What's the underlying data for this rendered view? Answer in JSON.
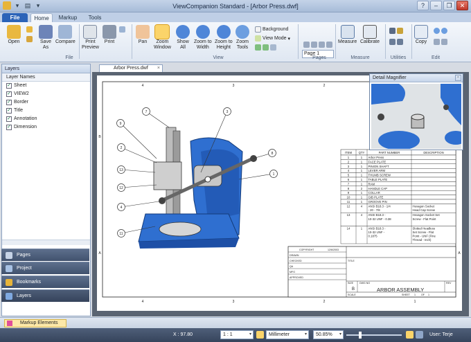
{
  "window": {
    "title": "ViewCompanion Standard - [Arbor Press.dwf]"
  },
  "ribbon_tabs": [
    {
      "label": "File"
    },
    {
      "label": "Home"
    },
    {
      "label": "Markup"
    },
    {
      "label": "Tools"
    }
  ],
  "ribbon": {
    "buttons": [
      {
        "label": "Open"
      },
      {
        "label": "Save\nAs"
      },
      {
        "label": "Compare"
      },
      {
        "label": "Print\nPreview"
      },
      {
        "label": "Print"
      },
      {
        "label": "Pan"
      },
      {
        "label": "Zoom\nWindow"
      },
      {
        "label": "Show\nAll"
      },
      {
        "label": "Zoom to\nWidth"
      },
      {
        "label": "Zoom to\nHeight"
      },
      {
        "label": "Zoom\nTools"
      },
      {
        "label": "Measure"
      },
      {
        "label": "Calibrate"
      },
      {
        "label": "Copy"
      }
    ],
    "small": {
      "background": "Background",
      "view_mode": "View Mode"
    },
    "page_select": "Page 1",
    "groups": {
      "file": "File",
      "view": "View",
      "pages": "Pages",
      "measure": "Measure",
      "utilities": "Utilities",
      "edit": "Edit"
    }
  },
  "layers_panel": {
    "title": "Layers",
    "column": "Layer Names",
    "items": [
      {
        "name": "Sheet",
        "checked": true
      },
      {
        "name": "VIEW2",
        "checked": true
      },
      {
        "name": "Border",
        "checked": true
      },
      {
        "name": "Title",
        "checked": true
      },
      {
        "name": "Annotation",
        "checked": true
      },
      {
        "name": "Dimension",
        "checked": true
      }
    ]
  },
  "nav_buttons": [
    {
      "label": "Pages"
    },
    {
      "label": "Project"
    },
    {
      "label": "Bookmarks"
    },
    {
      "label": "Layers"
    }
  ],
  "document_tab": {
    "label": "Arbor Press.dwf"
  },
  "magnifier": {
    "title": "Detail Magnifier"
  },
  "drawing": {
    "border_numbers": [
      "4",
      "3",
      "2",
      "1"
    ],
    "border_letters": [
      "B",
      "A"
    ],
    "balloons": [
      "7",
      "9",
      "3",
      "2",
      "13",
      "12",
      "4",
      "11",
      "8",
      "1"
    ],
    "bom_header": [
      "ITEM",
      "QTY",
      "PART NUMBER",
      "DESCRIPTION"
    ],
    "bom_rows": [
      [
        "1",
        "1",
        "Arbor Press",
        ""
      ],
      [
        "2",
        "1",
        "FACE PLATE",
        ""
      ],
      [
        "3",
        "1",
        "PINION SHAFT",
        ""
      ],
      [
        "4",
        "1",
        "LEVER ARM",
        ""
      ],
      [
        "5",
        "1",
        "THUMB SCREW",
        ""
      ],
      [
        "6",
        "1",
        "TABLE PLATE",
        ""
      ],
      [
        "7",
        "1",
        "RAM",
        ""
      ],
      [
        "8",
        "2",
        "HANDLE CAP",
        ""
      ],
      [
        "9",
        "1",
        "COLLAR",
        ""
      ],
      [
        "10",
        "1",
        "GIB PLATE",
        ""
      ],
      [
        "11",
        "1",
        "GROOVE PIN",
        ""
      ],
      [
        "12",
        "4",
        "ANSI B18.3 - 1/4 - 20 - 7/8",
        "Hexagon Socket Head Cap Screw"
      ],
      [
        "13",
        "4",
        "ANSI B18.3 - 10-32 UNF - 0.38",
        "Hexagon Socket Set Screw - Flat Point"
      ],
      [
        "14",
        "1",
        "ANSI B18.3 - 10-32 UNF - 0.1875",
        "Slotted Headless Set Screw - Flat Point - UNF (Fine Thread - Inch)"
      ]
    ],
    "title_block": {
      "copyright": "COPYRIGHT",
      "date": "12/6/2003",
      "drawn": "DRAWN",
      "checked": "CHECKED",
      "qa": "QA",
      "mfg": "MFG",
      "approved": "APPROVED",
      "title_label": "TITLE",
      "size_label": "SIZE",
      "size": "B",
      "dwg_label": "DWG NO",
      "rev_label": "REV",
      "title": "ARBOR ASSEMBLY",
      "scale_label": "SCALE",
      "sheet_label": "SHEET",
      "sheet": "1",
      "of": "OF",
      "of_value": "1"
    }
  },
  "markup_elements": {
    "label": "Markup Elements"
  },
  "status": {
    "coordinate": "X : 97.80",
    "scale": "1 : 1",
    "units": "Millimeter",
    "zoom": "50.85%",
    "user": "User: Terje"
  },
  "colors": {
    "accent": "#2b63b8",
    "part_blue": "#2f6fd0",
    "part_grey": "#bcbcbc"
  }
}
